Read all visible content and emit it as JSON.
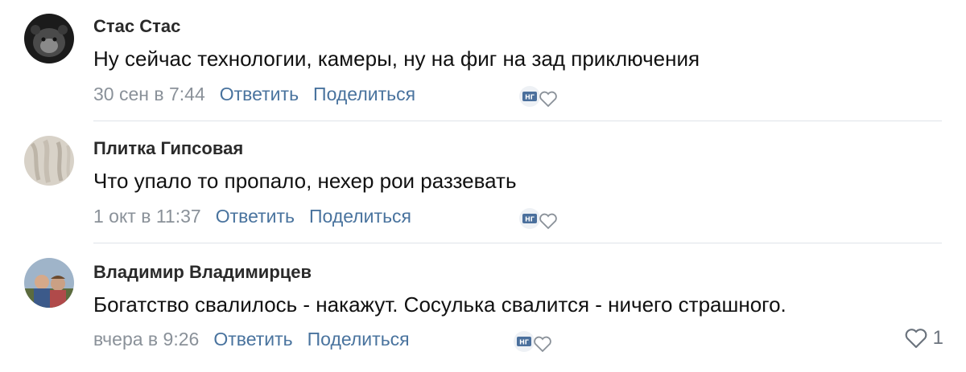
{
  "comments": [
    {
      "author": "Стас Стас",
      "text": "Ну сейчас технологии, камеры, ну на фиг на зад приключения",
      "date": "30 сен в 7:44",
      "reply_label": "Ответить",
      "share_label": "Поделиться"
    },
    {
      "author": "Плитка Гипсовая",
      "text": "Что упало то пропало, нехер рои раззевать",
      "date": "1 окт в 11:37",
      "reply_label": "Ответить",
      "share_label": "Поделиться"
    },
    {
      "author": "Владимир Владимирцев",
      "text": "Богатство свалилось - накажут. Сосулька свалится - ничего страшного.",
      "date": "вчера в 9:26",
      "reply_label": "Ответить",
      "share_label": "Поделиться",
      "like_count": "1"
    }
  ],
  "reaction_badge_text": "НГ",
  "colors": {
    "link": "#49739e",
    "date": "#8a9199",
    "divider": "#dfe3e8",
    "badge": "#4a6f9c"
  }
}
